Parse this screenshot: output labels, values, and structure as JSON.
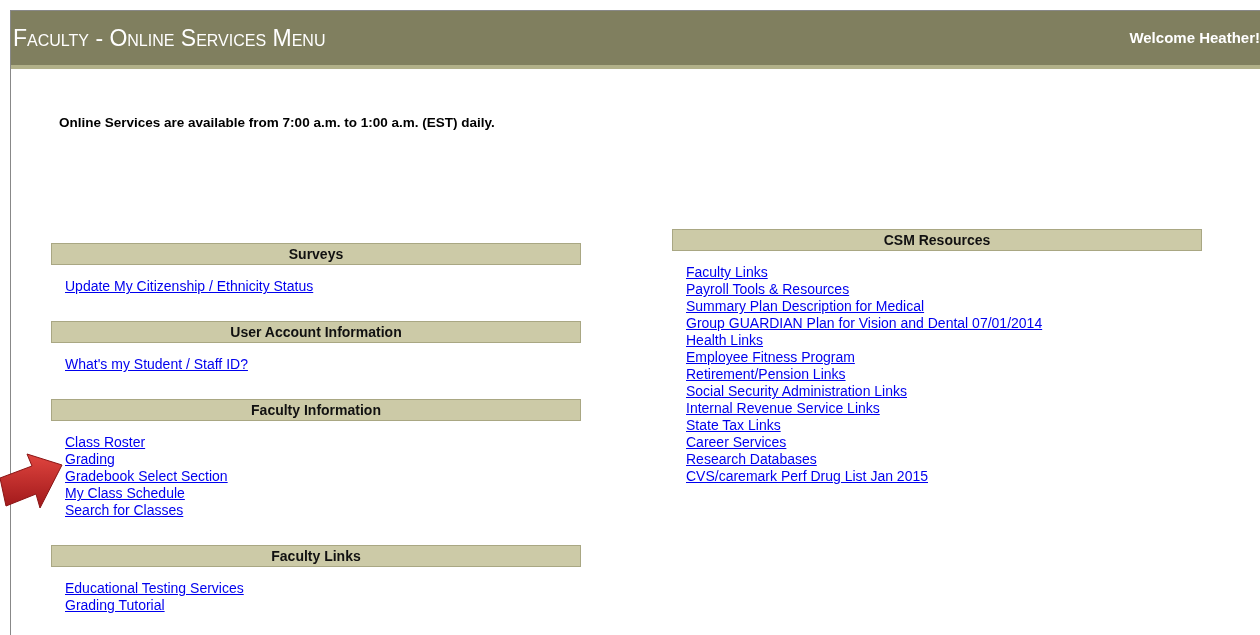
{
  "header": {
    "title": "Faculty - Online Services Menu",
    "welcome": "Welcome Heather!"
  },
  "notice": "Online Services are available from 7:00 a.m. to 1:00 a.m. (EST) daily.",
  "left_sections": [
    {
      "title": "Surveys",
      "links": [
        "Update My Citizenship / Ethnicity Status"
      ]
    },
    {
      "title": "User Account Information",
      "links": [
        "What's my Student / Staff ID?"
      ]
    },
    {
      "title": "Faculty Information",
      "links": [
        "Class Roster",
        "Grading",
        "Gradebook Select Section",
        "My Class Schedule",
        "Search for Classes"
      ]
    },
    {
      "title": "Faculty Links",
      "links": [
        "Educational Testing Services",
        "Grading Tutorial"
      ]
    }
  ],
  "right_sections": [
    {
      "title": "CSM Resources",
      "links": [
        "Faculty Links",
        "Payroll Tools & Resources",
        "Summary Plan Description for Medical",
        "Group GUARDIAN Plan for Vision and Dental 07/01/2014",
        "Health Links",
        "Employee Fitness Program",
        "Retirement/Pension Links",
        "Social Security Administration Links",
        "Internal Revenue Service Links",
        "State Tax Links",
        "Career Services",
        "Research Databases",
        "CVS/caremark Perf Drug List Jan 2015"
      ]
    }
  ]
}
